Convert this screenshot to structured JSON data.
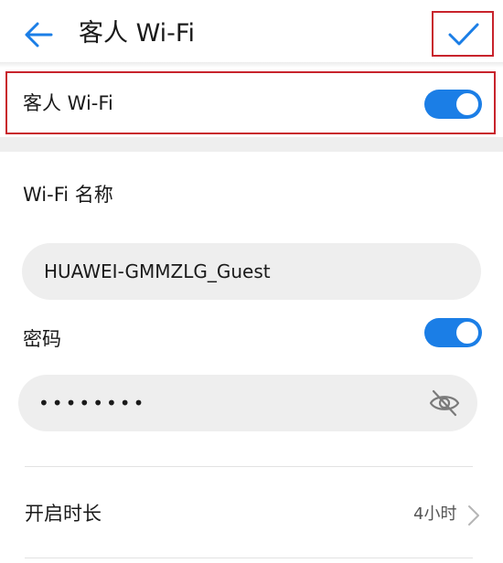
{
  "header": {
    "title": "客人 Wi-Fi",
    "back_icon": "arrow-left-icon",
    "confirm_icon": "checkmark-icon"
  },
  "guest_wifi": {
    "label": "客人 Wi-Fi",
    "enabled": true
  },
  "ssid": {
    "label": "Wi-Fi 名称",
    "value": "HUAWEI-GMMZLG_Guest"
  },
  "password": {
    "label": "密码",
    "enabled": true,
    "masked_value": "••••••••",
    "visibility_icon": "eye-off-icon"
  },
  "duration": {
    "label": "开启时长",
    "value": "4小时"
  },
  "colors": {
    "accent": "#1b7ee6",
    "highlight_border": "#c8232c",
    "field_background": "#eeeeee"
  }
}
